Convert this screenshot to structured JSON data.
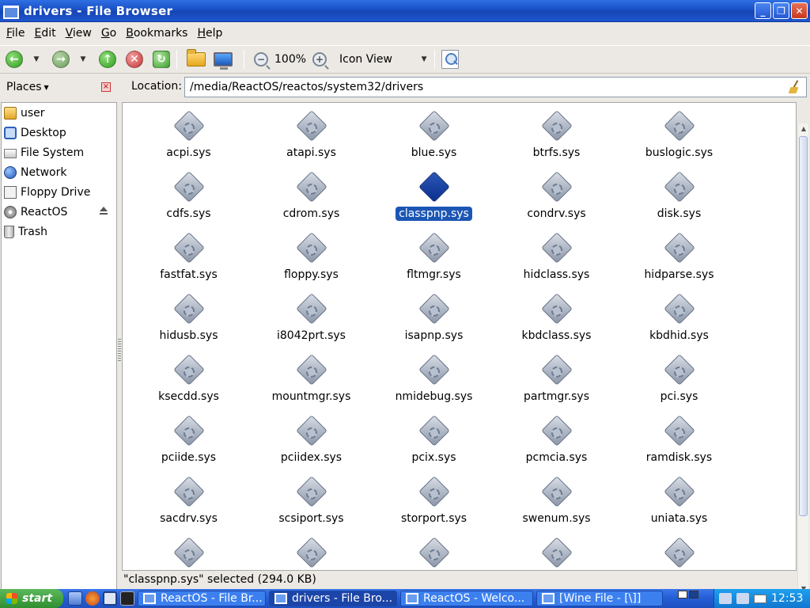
{
  "window": {
    "title": "drivers - File Browser",
    "buttons": {
      "minimize": "_",
      "maximize": "❐",
      "close": "✕"
    }
  },
  "menu": [
    {
      "label": "File",
      "accel": "F",
      "rest": "ile"
    },
    {
      "label": "Edit",
      "accel": "E",
      "rest": "dit"
    },
    {
      "label": "View",
      "accel": "V",
      "rest": "iew"
    },
    {
      "label": "Go",
      "accel": "G",
      "rest": "o"
    },
    {
      "label": "Bookmarks",
      "accel": "B",
      "rest": "ookmarks"
    },
    {
      "label": "Help",
      "accel": "H",
      "rest": "elp"
    }
  ],
  "toolbar": {
    "back_glyph": "←",
    "forward_glyph": "→",
    "up_glyph": "↑",
    "stop_glyph": "✕",
    "reload_glyph": "↻",
    "dropdown_glyph": "▼",
    "zoom_out_glyph": "−",
    "zoom_in_glyph": "+",
    "zoom_level": "100%",
    "view_mode": "Icon View"
  },
  "places": {
    "header": "Places",
    "header_arrow": "▼",
    "close_glyph": "×",
    "items": [
      {
        "label": "user",
        "icon": "home-folder-icon"
      },
      {
        "label": "Desktop",
        "icon": "desktop-icon"
      },
      {
        "label": "File System",
        "icon": "filesystem-icon"
      },
      {
        "label": "Network",
        "icon": "network-icon"
      },
      {
        "label": "Floppy Drive",
        "icon": "floppy-icon"
      },
      {
        "label": "ReactOS",
        "icon": "drive-icon",
        "eject": true
      },
      {
        "label": "Trash",
        "icon": "trash-icon"
      }
    ]
  },
  "location": {
    "label": "Location:",
    "path": "/media/ReactOS/reactos/system32/drivers"
  },
  "files": [
    "acpi.sys",
    "atapi.sys",
    "blue.sys",
    "btrfs.sys",
    "buslogic.sys",
    "cdfs.sys",
    "cdrom.sys",
    "classpnp.sys",
    "condrv.sys",
    "disk.sys",
    "fastfat.sys",
    "floppy.sys",
    "fltmgr.sys",
    "hidclass.sys",
    "hidparse.sys",
    "hidusb.sys",
    "i8042prt.sys",
    "isapnp.sys",
    "kbdclass.sys",
    "kbdhid.sys",
    "ksecdd.sys",
    "mountmgr.sys",
    "nmidebug.sys",
    "partmgr.sys",
    "pci.sys",
    "pciide.sys",
    "pciidex.sys",
    "pcix.sys",
    "pcmcia.sys",
    "ramdisk.sys",
    "sacdrv.sys",
    "scsiport.sys",
    "storport.sys",
    "swenum.sys",
    "uniata.sys",
    "",
    "",
    "",
    "",
    ""
  ],
  "selected_file": "classpnp.sys",
  "status": "\"classpnp.sys\" selected (294.0 KB)",
  "scrollbar": {
    "up_glyph": "▲",
    "down_glyph": "▼"
  },
  "taskbar": {
    "start_label": "start",
    "tasks": [
      {
        "label": "ReactOS - File Br...",
        "active": false
      },
      {
        "label": "drivers - File Bro...",
        "active": true
      },
      {
        "label": "ReactOS - Welco...",
        "active": false
      },
      {
        "label": "[Wine File - [\\]]",
        "active": false
      }
    ],
    "clock": "12:53"
  }
}
